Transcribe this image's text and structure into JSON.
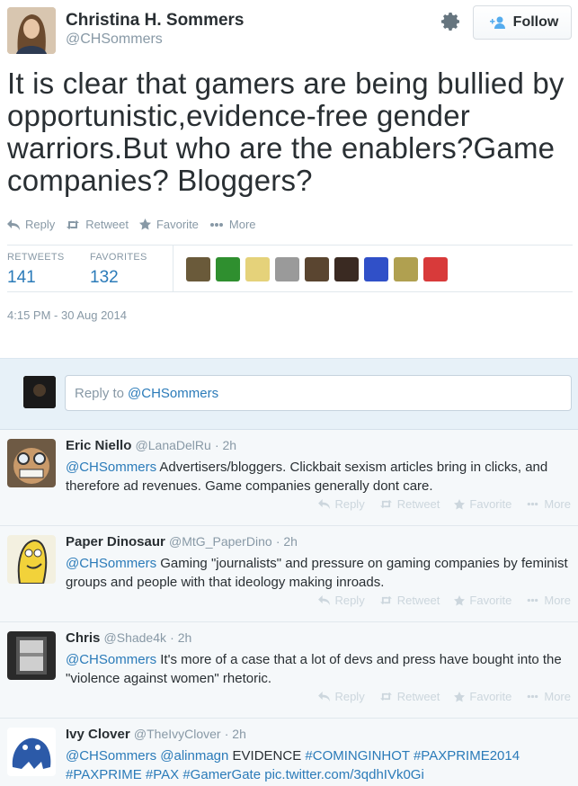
{
  "tweet": {
    "author_name": "Christina H. Sommers",
    "author_handle": "@CHSommers",
    "follow_label": "Follow",
    "text": "It is clear that gamers are being bullied by opportunistic,evidence-free gender warriors.But who are the enablers?Game companies? Bloggers?",
    "actions": {
      "reply": "Reply",
      "retweet": "Retweet",
      "favorite": "Favorite",
      "more": "More"
    },
    "stats": {
      "retweets_label": "RETWEETS",
      "retweets_value": "141",
      "favorites_label": "FAVORITES",
      "favorites_value": "132"
    },
    "timestamp": "4:15 PM - 30 Aug 2014"
  },
  "reply_box": {
    "prefix": "Reply to",
    "mention": "@CHSommers"
  },
  "replies": [
    {
      "name": "Eric Niello",
      "handle": "@LanaDelRu",
      "time": "· 2h",
      "mention": "@CHSommers",
      "text": "Advertisers/bloggers. Clickbait sexism articles bring in clicks, and therefore ad revenues. Game companies generally dont care."
    },
    {
      "name": "Paper Dinosaur",
      "handle": "@MtG_PaperDino",
      "time": "· 2h",
      "mention": "@CHSommers",
      "text": "Gaming \"journalists\" and pressure on gaming companies by feminist groups and people with that ideology making inroads."
    },
    {
      "name": "Chris",
      "handle": "@Shade4k",
      "time": "· 2h",
      "mention": "@CHSommers",
      "text": "It's more of a case that a lot of devs and press have bought into the \"violence against women\" rhetoric."
    },
    {
      "name": "Ivy Clover",
      "handle": "@TheIvyClover",
      "time": "· 2h",
      "mention": "@CHSommers",
      "mention2": "@alinmagn",
      "plain": "EVIDENCE",
      "tag1": "#COMINGINHOT",
      "tag2": "#PAXPRIME2014",
      "tag3": "#PAXPRIME",
      "tag4": "#PAX",
      "tag5": "#GamerGate",
      "link": "pic.twitter.com/3qdhIVk0Gi"
    }
  ],
  "colors": {
    "link": "#2b7bb9",
    "muted": "#8899a6",
    "reply_bg": "#f5f8fa",
    "reply_area_bg": "#e7f1f8"
  }
}
